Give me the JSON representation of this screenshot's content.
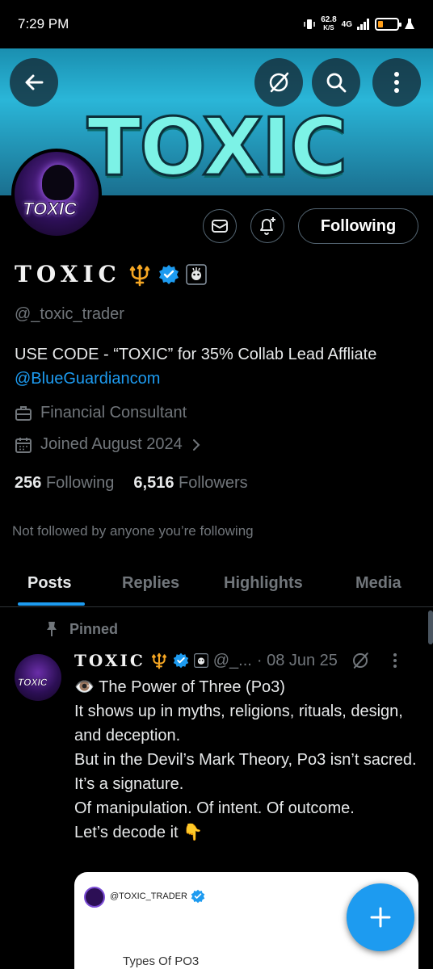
{
  "status_bar": {
    "time": "7:29 PM",
    "net_speed": "62.8",
    "net_unit": "K/S",
    "network": "4G",
    "battery_level_percent": 15
  },
  "banner": {
    "title": "TOXIC"
  },
  "header_buttons": {
    "back_icon": "arrow-left-icon",
    "grok_icon": "slash-circle-icon",
    "search_icon": "search-icon",
    "more_icon": "more-vertical-icon"
  },
  "avatar": {
    "label": "TOXIC"
  },
  "actions": {
    "message_icon": "envelope-icon",
    "notify_icon": "bell-plus-icon",
    "follow_label": "Following"
  },
  "profile": {
    "display_name": "TOXIC",
    "handle": "@_toxic_trader",
    "bio_text": "USE CODE - “TOXIC” for 35% Collab Lead Affliate ",
    "bio_link": "@BlueGuardiancom",
    "job": "Financial Consultant",
    "joined": "Joined August 2024",
    "following_count": "256",
    "following_label": "Following",
    "followers_count": "6,516",
    "followers_label": "Followers",
    "not_followed": "Not followed by anyone you’re following"
  },
  "tabs": [
    {
      "label": "Posts"
    },
    {
      "label": "Replies"
    },
    {
      "label": "Highlights"
    },
    {
      "label": "Media"
    }
  ],
  "post": {
    "pinned_label": "Pinned",
    "author": "TOXIC",
    "handle": "@_...",
    "date": "· 08 Jun 25",
    "avatar_label": "TOXIC",
    "lines": [
      "👁️ The Power of Three (Po3)",
      "It shows up in myths, religions, rituals, design, and deception.",
      "But in the Devil’s Mark Theory, Po3 isn’t sacred.",
      "It’s a signature.",
      "Of manipulation. Of intent. Of outcome.",
      "Let’s decode it 👇"
    ],
    "embed_handle": "@TOXIC_TRADER",
    "embed_subtitle": "Types Of PO3"
  },
  "colors": {
    "accent": "#1d9bf0",
    "muted": "#71767b",
    "verified": "#1d9bf0",
    "trident": "#f5a623"
  }
}
